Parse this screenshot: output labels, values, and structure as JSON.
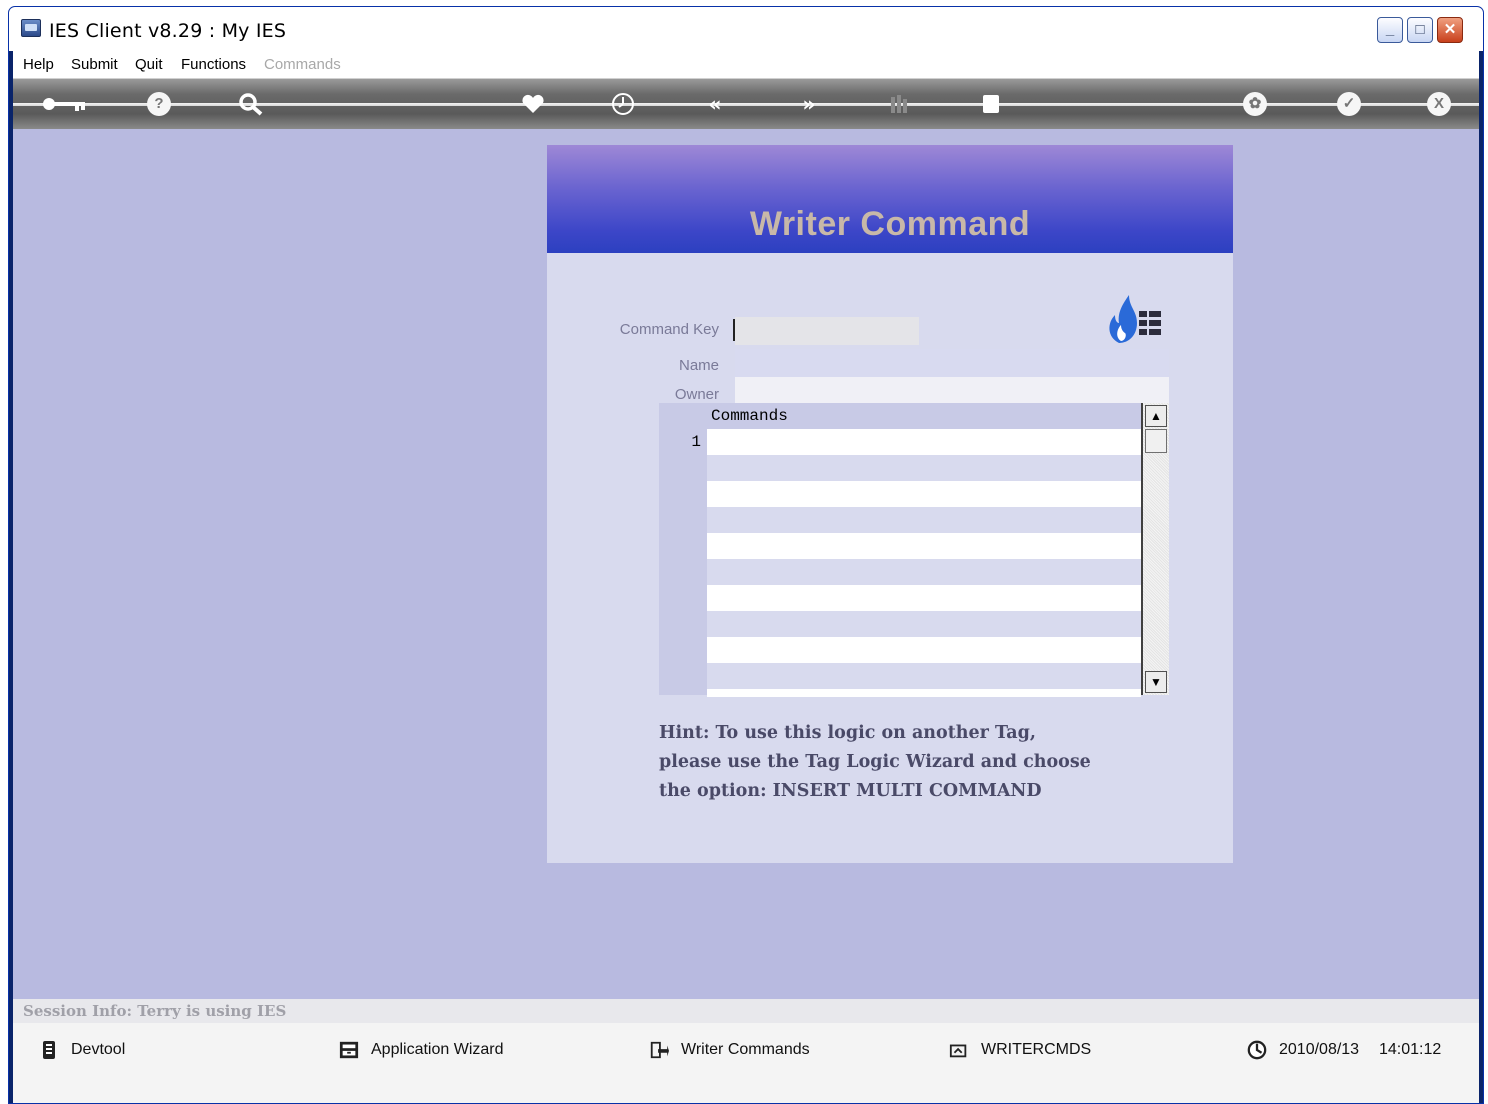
{
  "window": {
    "title": "IES Client v8.29 : My IES",
    "controls": {
      "minimize": "_",
      "maximize": "□",
      "close": "✕"
    }
  },
  "menu": {
    "items": [
      "Help",
      "Submit",
      "Quit",
      "Functions",
      "Commands"
    ],
    "disabled": [
      "Commands"
    ]
  },
  "toolbar": {
    "icons": [
      "key-icon",
      "help-icon",
      "search-icon",
      "heart-icon",
      "clock-icon",
      "back-icon",
      "forward-icon",
      "columns-icon",
      "stop-icon",
      "recycle-icon",
      "check-icon",
      "close-icon"
    ],
    "glyphs": {
      "back": "«",
      "forward": "»",
      "help": "?",
      "check": "✓",
      "close": "X"
    }
  },
  "dialog": {
    "title": "Writer Command",
    "fields": {
      "command_key": {
        "label": "Command Key",
        "value": ""
      },
      "name": {
        "label": "Name",
        "value": ""
      },
      "owner": {
        "label": "Owner",
        "value": ""
      }
    },
    "grid": {
      "header": "Commands",
      "row_numbers": [
        "1"
      ],
      "rows": [
        "",
        "",
        "",
        "",
        "",
        "",
        "",
        "",
        "",
        "",
        ""
      ]
    },
    "hint_lines": [
      "Hint: To use this logic on another Tag,",
      "please use the Tag Logic Wizard and choose",
      "the option: INSERT MULTI COMMAND"
    ],
    "logo_icon": "flame-grid-logo"
  },
  "session": {
    "text": "Session Info: Terry is using IES"
  },
  "status": {
    "items": [
      {
        "icon": "devtool-icon",
        "label": "Devtool"
      },
      {
        "icon": "wizard-icon",
        "label": "Application Wizard"
      },
      {
        "icon": "writer-icon",
        "label": "Writer Commands"
      },
      {
        "icon": "tag-icon",
        "label": "WRITERCMDS"
      }
    ],
    "date": "2010/08/13",
    "time": "14:01:12"
  },
  "colors": {
    "workspace": "#b8bae0",
    "dialog_body": "#d8daee",
    "header_top": "#9e88d6",
    "header_bottom": "#2c40c0",
    "title_text": "#c8b8a8",
    "logo_flame": "#2a6ad8"
  }
}
